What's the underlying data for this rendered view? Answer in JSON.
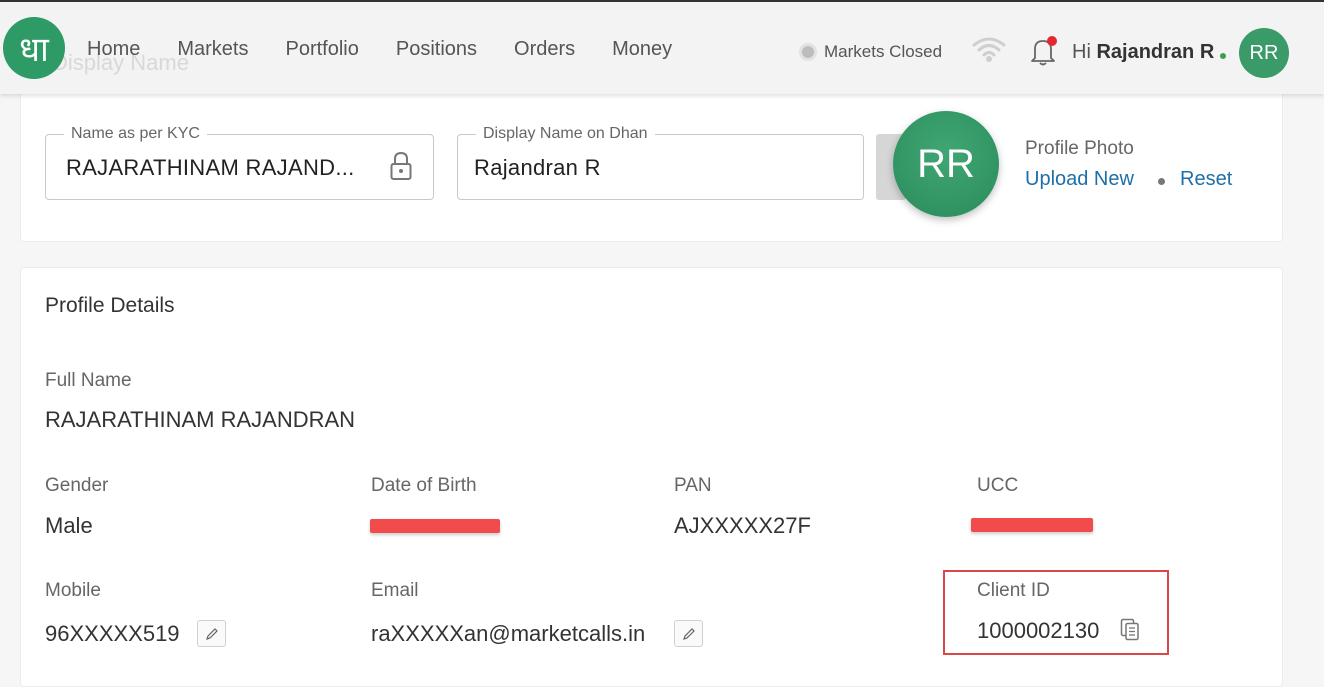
{
  "header": {
    "ghost_title": "Display Name",
    "logo_glyph": "धा",
    "nav": [
      {
        "label": "Home"
      },
      {
        "label": "Markets"
      },
      {
        "label": "Portfolio"
      },
      {
        "label": "Positions"
      },
      {
        "label": "Orders"
      },
      {
        "label": "Money"
      }
    ],
    "market_status": "Markets Closed",
    "greeting_prefix": "Hi",
    "user_name": "Rajandran R",
    "avatar_initials": "RR"
  },
  "display_name_card": {
    "kyc_label": "Name as per KYC",
    "kyc_value": "RAJARATHINAM RAJAND...",
    "display_label": "Display Name on Dhan",
    "display_value": "Rajandran R",
    "avatar_initials": "RR",
    "photo_label": "Profile Photo",
    "upload_label": "Upload New",
    "reset_label": "Reset"
  },
  "profile_details": {
    "title": "Profile Details",
    "full_name_label": "Full Name",
    "full_name": "RAJARATHINAM RAJANDRAN",
    "gender_label": "Gender",
    "gender": "Male",
    "dob_label": "Date of Birth",
    "pan_label": "PAN",
    "pan": "AJXXXXX27F",
    "ucc_label": "UCC",
    "mobile_label": "Mobile",
    "mobile": "96XXXXX519",
    "email_label": "Email",
    "email": "raXXXXXan@marketcalls.in",
    "client_id_label": "Client ID",
    "client_id": "1000002130"
  },
  "colors": {
    "brand_green": "#2e9a66",
    "link_blue": "#1f6fa8",
    "redaction_red": "#f24b4b",
    "highlight_red": "#d9474b"
  }
}
